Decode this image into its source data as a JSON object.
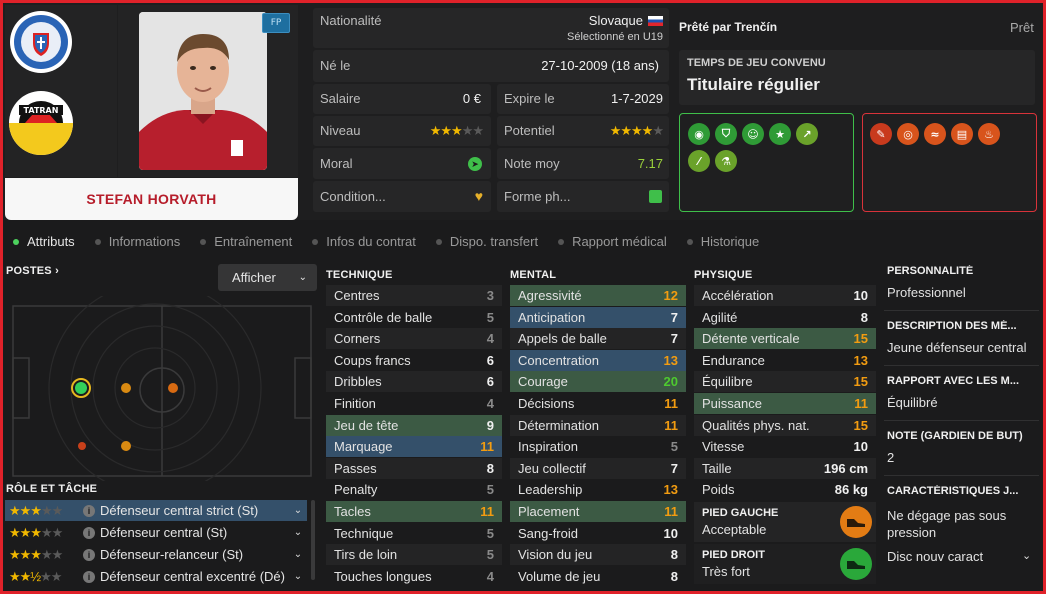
{
  "player": {
    "name": "STEFAN HORVATH",
    "position_badge": "FP"
  },
  "info": {
    "nationality_label": "Nationalité",
    "nationality_value": "Slovaque",
    "nationality_sub": "Sélectionné en U19",
    "born_label": "Né le",
    "born_value": "27-10-2009 (18 ans)",
    "salary_label": "Salaire",
    "salary_value": "0 €",
    "expiry_label": "Expire le",
    "expiry_value": "1-7-2029",
    "level_label": "Niveau",
    "level_stars": "★★★",
    "level_stars_dim": "★★",
    "potential_label": "Potentiel",
    "potential_stars": "★★★★",
    "potential_stars_dim": "★",
    "morale_label": "Moral",
    "avg_label": "Note moy",
    "avg_value": "7.17",
    "condition_label": "Condition...",
    "form_label": "Forme ph..."
  },
  "loan": {
    "title": "Prêté par Trenčín",
    "status": "Prêt",
    "playtime_label": "TEMPS DE JEU CONVENU",
    "playtime_value": "Titulaire régulier"
  },
  "tabs": [
    "Attributs",
    "Informations",
    "Entraînement",
    "Infos du contrat",
    "Dispo. transfert",
    "Rapport médical",
    "Historique"
  ],
  "positions": {
    "title": "POSTES",
    "button": "Afficher"
  },
  "roles": {
    "title": "RÔLE ET TÂCHE",
    "items": [
      {
        "name": "Défenseur central strict (St)",
        "stars": "★★★",
        "dim": "★★"
      },
      {
        "name": "Défenseur central (St)",
        "stars": "★★★",
        "dim": "★★"
      },
      {
        "name": "Défenseur-relanceur (St)",
        "stars": "★★★",
        "dim": "★★"
      },
      {
        "name": "Défenseur central excentré (Dé)",
        "stars": "★★½",
        "dim": "★★"
      }
    ]
  },
  "technique": {
    "title": "TECHNIQUE",
    "rows": [
      {
        "name": "Centres",
        "value": "3"
      },
      {
        "name": "Contrôle de balle",
        "value": "5"
      },
      {
        "name": "Corners",
        "value": "4"
      },
      {
        "name": "Coups francs",
        "value": "6"
      },
      {
        "name": "Dribbles",
        "value": "6"
      },
      {
        "name": "Finition",
        "value": "4"
      },
      {
        "name": "Jeu de tête",
        "value": "9"
      },
      {
        "name": "Marquage",
        "value": "11"
      },
      {
        "name": "Passes",
        "value": "8"
      },
      {
        "name": "Penalty",
        "value": "5"
      },
      {
        "name": "Tacles",
        "value": "11"
      },
      {
        "name": "Technique",
        "value": "5"
      },
      {
        "name": "Tirs de loin",
        "value": "5"
      },
      {
        "name": "Touches longues",
        "value": "4"
      }
    ]
  },
  "mental": {
    "title": "MENTAL",
    "rows": [
      {
        "name": "Agressivité",
        "value": "12"
      },
      {
        "name": "Anticipation",
        "value": "7"
      },
      {
        "name": "Appels de balle",
        "value": "7"
      },
      {
        "name": "Concentration",
        "value": "13"
      },
      {
        "name": "Courage",
        "value": "20"
      },
      {
        "name": "Décisions",
        "value": "11"
      },
      {
        "name": "Détermination",
        "value": "11"
      },
      {
        "name": "Inspiration",
        "value": "5"
      },
      {
        "name": "Jeu collectif",
        "value": "7"
      },
      {
        "name": "Leadership",
        "value": "13"
      },
      {
        "name": "Placement",
        "value": "11"
      },
      {
        "name": "Sang-froid",
        "value": "10"
      },
      {
        "name": "Vision du jeu",
        "value": "8"
      },
      {
        "name": "Volume de jeu",
        "value": "8"
      }
    ]
  },
  "physique": {
    "title": "PHYSIQUE",
    "rows": [
      {
        "name": "Accélération",
        "value": "10"
      },
      {
        "name": "Agilité",
        "value": "8"
      },
      {
        "name": "Détente verticale",
        "value": "15"
      },
      {
        "name": "Endurance",
        "value": "13"
      },
      {
        "name": "Équilibre",
        "value": "15"
      },
      {
        "name": "Puissance",
        "value": "11"
      },
      {
        "name": "Qualités phys. nat.",
        "value": "15"
      },
      {
        "name": "Vitesse",
        "value": "10"
      },
      {
        "name": "Taille",
        "value": "196 cm"
      },
      {
        "name": "Poids",
        "value": "86 kg"
      }
    ],
    "left_foot_label": "PIED GAUCHE",
    "left_foot_value": "Acceptable",
    "right_foot_label": "PIED DROIT",
    "right_foot_value": "Très fort"
  },
  "side": {
    "personality_label": "PERSONNALITÉ",
    "personality_value": "Professionnel",
    "description_label": "DESCRIPTION DES MÉ...",
    "description_value": "Jeune défenseur central",
    "relation_label": "RAPPORT AVEC LES M...",
    "relation_value": "Équilibré",
    "gk_label": "NOTE (GARDIEN DE BUT)",
    "gk_value": "2",
    "traits_label": "CARACTÉRISTIQUES J...",
    "traits_value": "Ne dégage pas sous pression",
    "traits_extra": "Disc nouv caract"
  },
  "colors": {
    "accent_red": "#e0222a",
    "green_border": "#3fbf4a",
    "red_border": "#d8333a",
    "star": "#f1b800",
    "orange_value": "#f29c11",
    "green_value": "#4ec92f"
  }
}
